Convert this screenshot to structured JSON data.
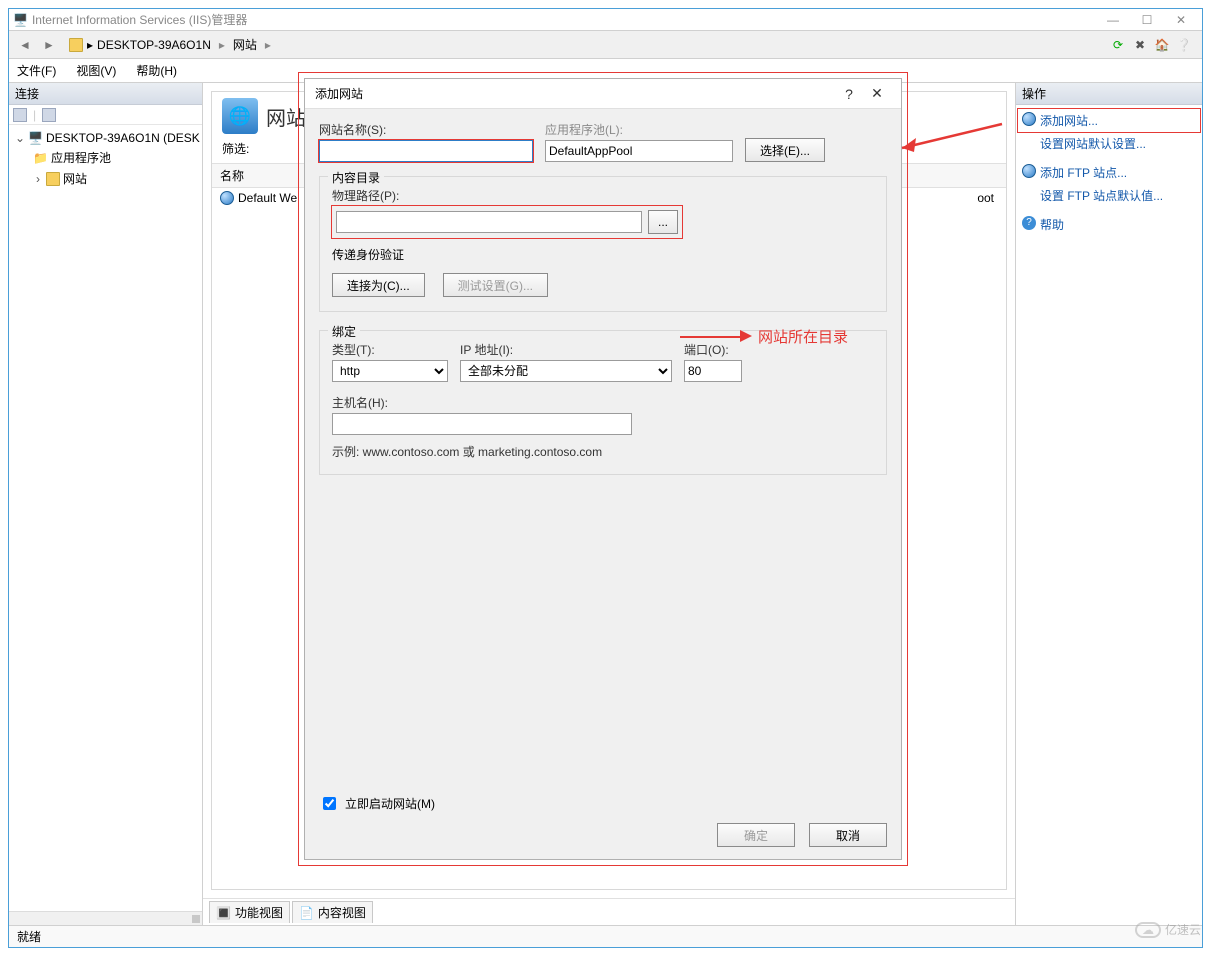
{
  "window": {
    "title": "Internet Information Services (IIS)管理器"
  },
  "breadcrumb": {
    "host": "DESKTOP-39A6O1N",
    "node": "网站"
  },
  "menubar": {
    "file": "文件(F)",
    "view": "视图(V)",
    "help": "帮助(H)"
  },
  "left": {
    "header": "连接",
    "tree": {
      "root": "DESKTOP-39A6O1N (DESK",
      "apppools": "应用程序池",
      "sites": "网站"
    }
  },
  "center": {
    "title": "网站",
    "filter_label": "筛选:",
    "column_name": "名称",
    "row0": "Default We",
    "row0_suffix": "oot",
    "tab_features": "功能视图",
    "tab_content": "内容视图"
  },
  "right": {
    "header": "操作",
    "add_site": "添加网站...",
    "set_defaults": "设置网站默认设置...",
    "add_ftp": "添加 FTP 站点...",
    "set_ftp_defaults": "设置 FTP 站点默认值...",
    "help": "帮助"
  },
  "dialog": {
    "title": "添加网站",
    "site_name_label": "网站名称(S):",
    "app_pool_label": "应用程序池(L):",
    "app_pool_value": "DefaultAppPool",
    "select_btn": "选择(E)...",
    "content_group": "内容目录",
    "physical_path_label": "物理路径(P):",
    "browse_btn": "...",
    "passthrough": "传递身份验证",
    "connect_as": "连接为(C)...",
    "test_settings": "测试设置(G)...",
    "binding_group": "绑定",
    "type_label": "类型(T):",
    "type_value": "http",
    "ip_label": "IP 地址(I):",
    "ip_value": "全部未分配",
    "port_label": "端口(O):",
    "port_value": "80",
    "hostname_label": "主机名(H):",
    "hostname_example": "示例: www.contoso.com 或 marketing.contoso.com",
    "start_now": "立即启动网站(M)",
    "ok": "确定",
    "cancel": "取消"
  },
  "annotation": {
    "physical_path": "网站所在目录"
  },
  "statusbar": {
    "ready": "就绪"
  },
  "watermark": "亿速云"
}
